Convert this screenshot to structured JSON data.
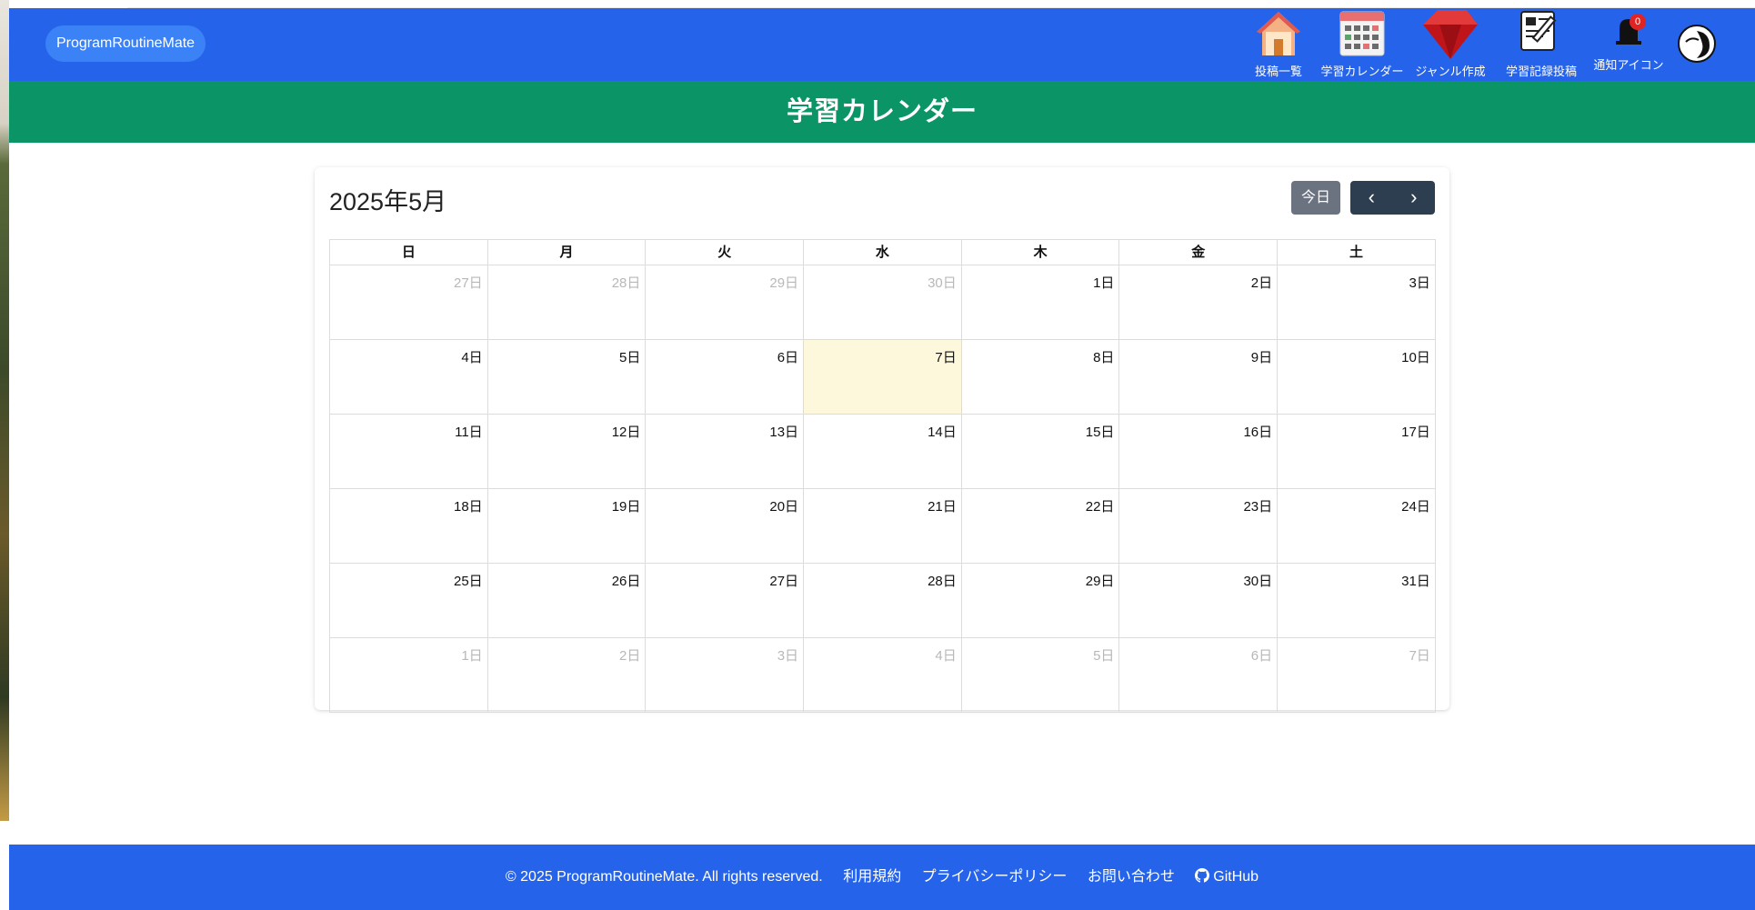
{
  "app": {
    "brand": "ProgramRoutineMate"
  },
  "nav": {
    "items": [
      {
        "label": "投稿一覧",
        "icon": "house-icon"
      },
      {
        "label": "学習カレンダー",
        "icon": "calendar-icon"
      },
      {
        "label": "ジャンル作成",
        "icon": "ruby-gem-icon"
      },
      {
        "label": "学習記録投稿",
        "icon": "notepad-pencil-icon"
      },
      {
        "label": "通知アイコン",
        "icon": "bell-icon",
        "badge": "0"
      }
    ],
    "avatar": "user-avatar"
  },
  "page": {
    "title": "学習カレンダー"
  },
  "calendar": {
    "month_label": "2025年5月",
    "today_label": "今日",
    "prev_icon": "‹",
    "next_icon": "›",
    "weekdays": [
      "日",
      "月",
      "火",
      "水",
      "木",
      "金",
      "土"
    ],
    "weeks": [
      [
        "27日",
        "28日",
        "29日",
        "30日",
        "1日",
        "2日",
        "3日"
      ],
      [
        "4日",
        "5日",
        "6日",
        "7日",
        "8日",
        "9日",
        "10日"
      ],
      [
        "11日",
        "12日",
        "13日",
        "14日",
        "15日",
        "16日",
        "17日"
      ],
      [
        "18日",
        "19日",
        "20日",
        "21日",
        "22日",
        "23日",
        "24日"
      ],
      [
        "25日",
        "26日",
        "27日",
        "28日",
        "29日",
        "30日",
        "31日"
      ],
      [
        "1日",
        "2日",
        "3日",
        "4日",
        "5日",
        "6日",
        "7日"
      ]
    ]
  },
  "footer": {
    "copyright": "© 2025 ProgramRoutineMate. All rights reserved.",
    "terms": "利用規約",
    "privacy": "プライバシーポリシー",
    "contact": "お問い合わせ",
    "github": "GitHub"
  },
  "colors": {
    "header": "#2563eb",
    "title_bar": "#0b9566",
    "today_highlight": "#fdf8dc",
    "nav_button": "#2c3e50"
  }
}
